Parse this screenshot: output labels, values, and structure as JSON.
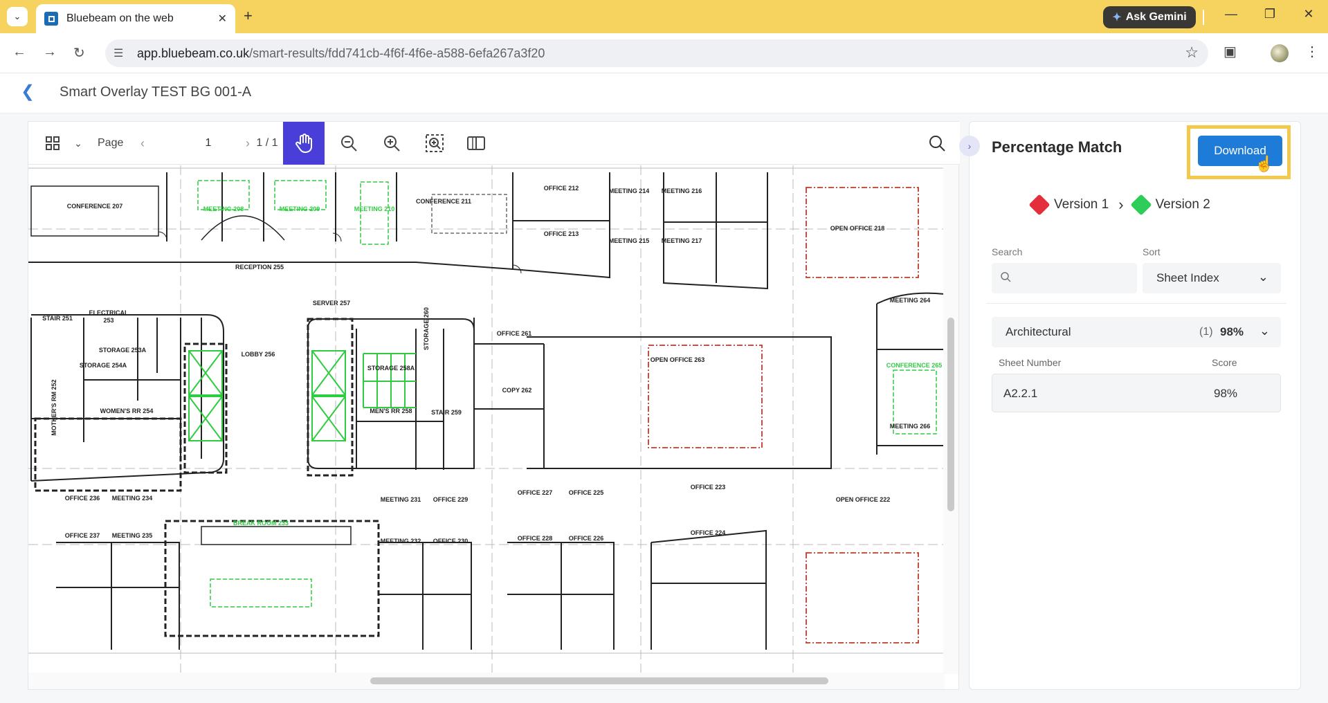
{
  "browser": {
    "tab_title": "Bluebeam on the web",
    "gemini_label": "Ask Gemini",
    "url_host": "app.bluebeam.co.uk",
    "url_path": "/smart-results/fdd741cb-4f6f-4f6e-a588-6efa267a3f20"
  },
  "header": {
    "title": "Smart Overlay TEST BG 001-A"
  },
  "toolbar": {
    "page_label": "Page",
    "page_value": "1",
    "page_count": "1 / 1"
  },
  "drawing": {
    "rooms": [
      "CONFERENCE 207",
      "MEETING 208",
      "MEETING 209",
      "MEETING 210",
      "CONFERENCE 211",
      "OFFICE 212",
      "OFFICE 213",
      "MEETING 214",
      "MEETING 215",
      "MEETING 216",
      "MEETING 217",
      "OPEN OFFICE 218",
      "RECEPTION 255",
      "STAIR 251",
      "ELECTRICAL",
      "253",
      "STORAGE 253A",
      "STORAGE 254A",
      "MOTHER'S RM 252",
      "WOMEN'S RR 254",
      "LOBBY 256",
      "SERVER 257",
      "STORAGE 260",
      "STORAGE 258A",
      "MEN'S RR 258",
      "STAIR 259",
      "OFFICE 261",
      "COPY 262",
      "OPEN OFFICE 263",
      "MEETING 264",
      "CONFERENCE 265",
      "MEETING 266",
      "OFFICE 236",
      "MEETING 234",
      "OFFICE 237",
      "MEETING 235",
      "BREAK ROOM 233",
      "MEETING 231",
      "OFFICE 229",
      "MEETING 232",
      "OFFICE 230",
      "OFFICE 227",
      "OFFICE 225",
      "OFFICE 228",
      "OFFICE 226",
      "OFFICE 223",
      "OFFICE 224",
      "OPEN OFFICE 222"
    ],
    "colors": {
      "added": "#2ecc40",
      "removed": "#c0392b"
    }
  },
  "panel": {
    "title": "Percentage Match",
    "download_label": "Download",
    "version1": "Version 1",
    "version2": "Version 2",
    "version1_color": "#e52e3b",
    "version2_color": "#2ecc59",
    "search_label": "Search",
    "search_placeholder": "",
    "sort_label": "Sort",
    "sort_value": "Sheet Index",
    "group": {
      "name": "Architectural",
      "count": "(1)",
      "score": "98%"
    },
    "columns": {
      "sheet": "Sheet Number",
      "score": "Score"
    },
    "rows": [
      {
        "sheet": "A2.2.1",
        "score": "98%"
      }
    ]
  }
}
